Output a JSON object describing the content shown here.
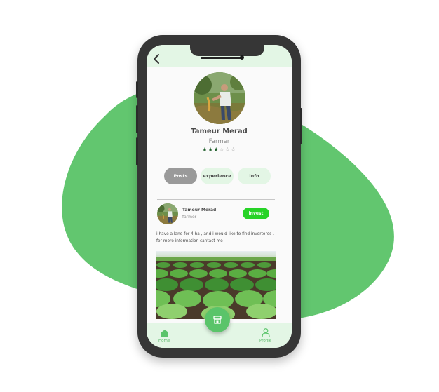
{
  "colors": {
    "blob": "#62c66f",
    "phone_frame": "#363636",
    "accent_green": "#27d327",
    "light_green": "#e3f6e5",
    "tab_active": "#9a9a9a",
    "star_filled": "#1e5e2a"
  },
  "header": {
    "back_icon": "chevron-left-icon"
  },
  "profile": {
    "name": "Tameur Merad",
    "role": "Farmer",
    "rating": 3,
    "rating_max": 6,
    "stars_filled": "★★★",
    "stars_empty": "☆☆☆"
  },
  "tabs": [
    {
      "label": "Posts",
      "active": true
    },
    {
      "label": "experience",
      "active": false
    },
    {
      "label": "info",
      "active": false
    }
  ],
  "post": {
    "author": "Tameur Merad",
    "author_role": "farmer",
    "action_label": "invest",
    "text": "i have a land for 4 ha , and i would like to find invertores . for more information cantact me"
  },
  "bottom_nav": {
    "home_label": "Home",
    "home_icon": "home-icon",
    "profile_label": "Profile",
    "profile_icon": "user-icon",
    "center_icon": "store-icon"
  }
}
